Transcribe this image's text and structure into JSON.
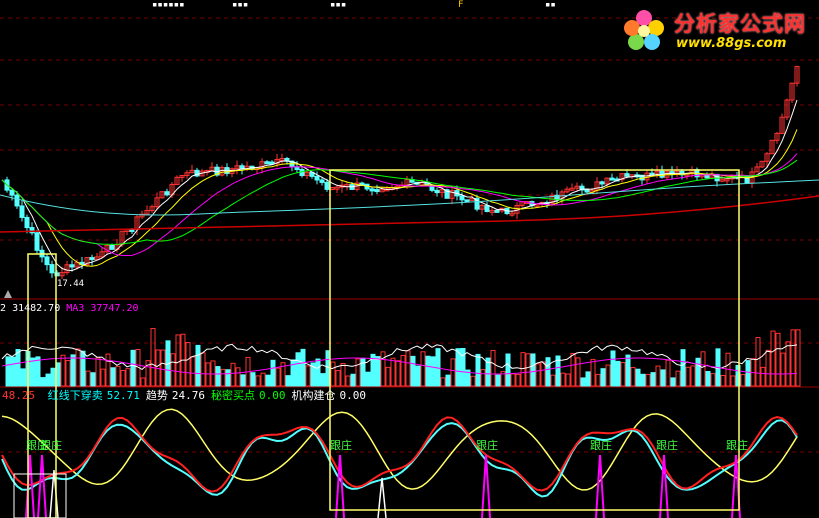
{
  "top_marks": {
    "left_group": "▪▪▪▪▪▪",
    "mid_group": "▪▪▪",
    "right_mark": "▪▪▪",
    "letter_f": "F",
    "end_mark": "▪▪"
  },
  "logo": {
    "title": "分析家公式网",
    "url": "www.88gs.com"
  },
  "price_panel": {
    "low_price_label": "17.44"
  },
  "volume_panel": {
    "ma2_label": "2",
    "ma2_value": "31482.70",
    "ma3_label": "MA3",
    "ma3_value": "37747.20"
  },
  "indicator_panel": {
    "first_value": "48.25",
    "items": [
      {
        "label": "红线下穿卖",
        "value": "52.71",
        "label_color": "#00ffff",
        "value_color": "#00ffff"
      },
      {
        "label": "趋势",
        "value": "24.76",
        "label_color": "#ffffff",
        "value_color": "#ffffff"
      },
      {
        "label": "秘密买点",
        "value": "0.00",
        "label_color": "#00ff00",
        "value_color": "#00ff00"
      },
      {
        "label": "机构建仓",
        "value": "0.00",
        "label_color": "#ffffff",
        "value_color": "#ffffff"
      }
    ],
    "genzhuang_label": "跟庄"
  },
  "colors": {
    "background": "#000000",
    "up": "#ff3232",
    "down": "#54ffff",
    "highlight_box": "#ffff66",
    "separator": "#9a0000",
    "ma_white": "#ffffff",
    "ma_yellow": "#ffff00",
    "ma_magenta": "#ff00ff",
    "ma_green": "#00ff00",
    "ma_cyan": "#55e0e0",
    "ma_red": "#cc0000"
  }
}
